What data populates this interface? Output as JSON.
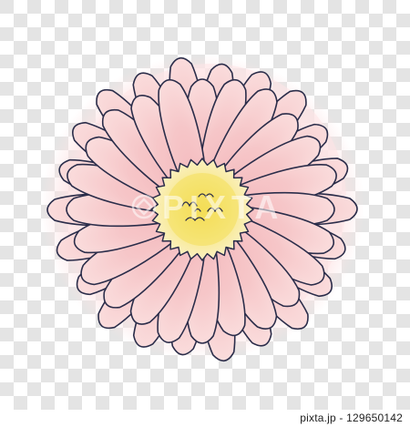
{
  "image": {
    "subject": "pink gerbera daisy",
    "background": "transparency checkerboard",
    "colors": {
      "checker_light": "#ffffff",
      "checker_dark": "#e4e4e4",
      "petal_fill": "#f6c4c6",
      "petal_fill_light": "#fadcdc",
      "glow": "#fde5e6",
      "outline": "#2b2d4a",
      "center_outer": "#fbe8a0",
      "center_inner": "#f4de5a"
    }
  },
  "watermark": {
    "text": "PIXTA"
  },
  "footer": {
    "credit": "pixta.jp - 129650142"
  }
}
